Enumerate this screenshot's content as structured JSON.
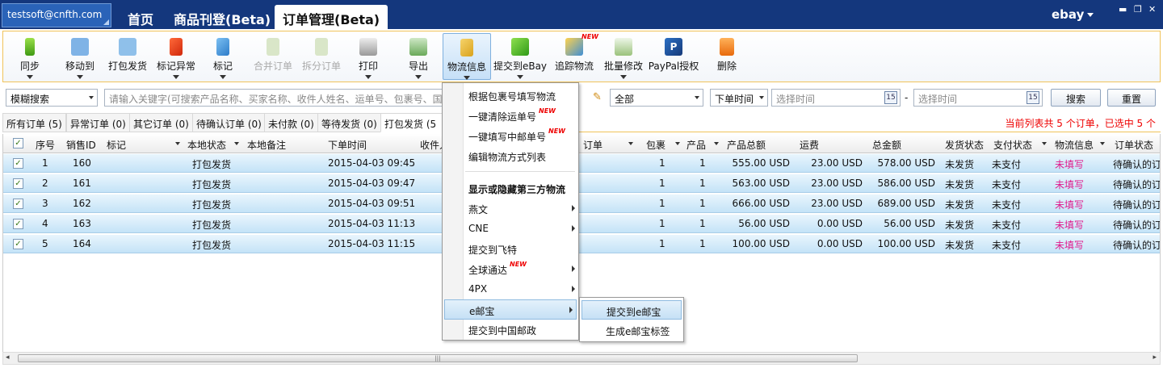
{
  "account": "testsoft@cnfth.com",
  "nav_tabs": [
    "首页",
    "商品刊登(Beta)",
    "订单管理(Beta)"
  ],
  "platform": "ebay",
  "toolbar": {
    "sync": "同步",
    "move_to": "移动到",
    "pack_ship": "打包发货",
    "mark_exception": "标记异常",
    "mark": "标记",
    "merge_order": "合并订单",
    "split_order": "拆分订单",
    "print": "打印",
    "export": "导出",
    "logistics_info": "物流信息",
    "submit_ebay": "提交到eBay",
    "track_logistics": "追踪物流",
    "batch_modify": "批量修改",
    "paypal_auth": "PayPal授权",
    "delete": "删除",
    "new_badge": "NEW"
  },
  "search": {
    "mode": "模糊搜索",
    "keyword_placeholder": "请输入关键字(可搜索产品名称、买家名称、收件人姓名、运单号、包裹号、国",
    "status_value": "全部",
    "time_field": "下单时间",
    "start_placeholder": "选择时间",
    "dash": "-",
    "end_placeholder": "选择时间",
    "calendar_day": "15",
    "search_button": "搜索",
    "reset_button": "重置"
  },
  "filter_tabs": [
    {
      "label": "所有订单 (5)"
    },
    {
      "label": "异常订单 (0)"
    },
    {
      "label": "其它订单 (0)"
    },
    {
      "label": "待确认订单 (0)"
    },
    {
      "label": "未付款 (0)"
    },
    {
      "label": "等待发货 (0)"
    },
    {
      "label": "打包发货 (5"
    }
  ],
  "summary": "当前列表共 5 个订单，已选中 5 个",
  "columns": {
    "seq": "序号",
    "sale_id": "销售ID",
    "mark": "标记",
    "local_status": "本地状态",
    "local_note": "本地备注",
    "order_time": "下单时间",
    "recipient": "收件人",
    "order": "订单",
    "package": "包裹",
    "product": "产品",
    "product_total": "产品总额",
    "shipping": "运费",
    "total": "总金额",
    "ship_status": "发货状态",
    "pay_status": "支付状态",
    "logistics_info": "物流信息",
    "order_status": "订单状态"
  },
  "rows": [
    {
      "seq": "1",
      "sale_id": "160",
      "status": "打包发货",
      "time": "2015-04-03 09:45",
      "pkg": "1",
      "prod": "1",
      "prod_total": "555.00 USD",
      "shipping": "23.00 USD",
      "total": "578.00 USD",
      "ship": "未发货",
      "pay": "未支付",
      "logi": "未填写",
      "order_status": "待确认的订"
    },
    {
      "seq": "2",
      "sale_id": "161",
      "status": "打包发货",
      "time": "2015-04-03 09:47",
      "pkg": "1",
      "prod": "1",
      "prod_total": "563.00 USD",
      "shipping": "23.00 USD",
      "total": "586.00 USD",
      "ship": "未发货",
      "pay": "未支付",
      "logi": "未填写",
      "order_status": "待确认的订"
    },
    {
      "seq": "3",
      "sale_id": "162",
      "status": "打包发货",
      "time": "2015-04-03 09:51",
      "pkg": "1",
      "prod": "1",
      "prod_total": "666.00 USD",
      "shipping": "23.00 USD",
      "total": "689.00 USD",
      "ship": "未发货",
      "pay": "未支付",
      "logi": "未填写",
      "order_status": "待确认的订"
    },
    {
      "seq": "4",
      "sale_id": "163",
      "status": "打包发货",
      "time": "2015-04-03 11:13",
      "pkg": "1",
      "prod": "1",
      "prod_total": "56.00 USD",
      "shipping": "0.00 USD",
      "total": "56.00 USD",
      "ship": "未发货",
      "pay": "未支付",
      "logi": "未填写",
      "order_status": "待确认的订"
    },
    {
      "seq": "5",
      "sale_id": "164",
      "status": "打包发货",
      "time": "2015-04-03 11:15",
      "pkg": "1",
      "prod": "1",
      "prod_total": "100.00 USD",
      "shipping": "0.00 USD",
      "total": "100.00 USD",
      "ship": "未发货",
      "pay": "未支付",
      "logi": "未填写",
      "order_status": "待确认的订"
    }
  ],
  "menu": [
    {
      "label": "根据包裹号填写物流"
    },
    {
      "label": "一键清除运单号"
    },
    {
      "label": "一键填写中邮单号"
    },
    {
      "label": "编辑物流方式列表"
    },
    {
      "label": "显示或隐藏第三方物流"
    },
    {
      "label": "燕文"
    },
    {
      "label": "CNE"
    },
    {
      "label": "提交到飞特"
    },
    {
      "label": "全球通达"
    },
    {
      "label": "4PX"
    },
    {
      "label": "e邮宝"
    },
    {
      "label": "提交到中国邮政"
    }
  ],
  "submenu": [
    {
      "label": "提交到e邮宝"
    },
    {
      "label": "生成e邮宝标签"
    }
  ],
  "colors": {
    "accent": "#14377d",
    "highlight_text": "#e0198c",
    "alert": "#e00000"
  }
}
